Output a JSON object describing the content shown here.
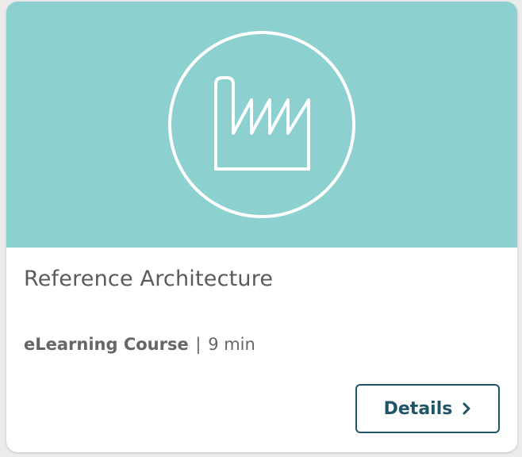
{
  "card": {
    "title": "Reference Architecture",
    "course_type": "eLearning Course",
    "separator": "|",
    "duration": "9 min",
    "details_label": "Details",
    "hero_icon": "factory-icon",
    "chevron_icon": "chevron-right-icon"
  },
  "colors": {
    "hero_background": "#8dd0d0",
    "icon_stroke": "#ffffff",
    "button_accent": "#1f5566",
    "title_text": "#5a5a5a",
    "meta_text": "#666666"
  }
}
